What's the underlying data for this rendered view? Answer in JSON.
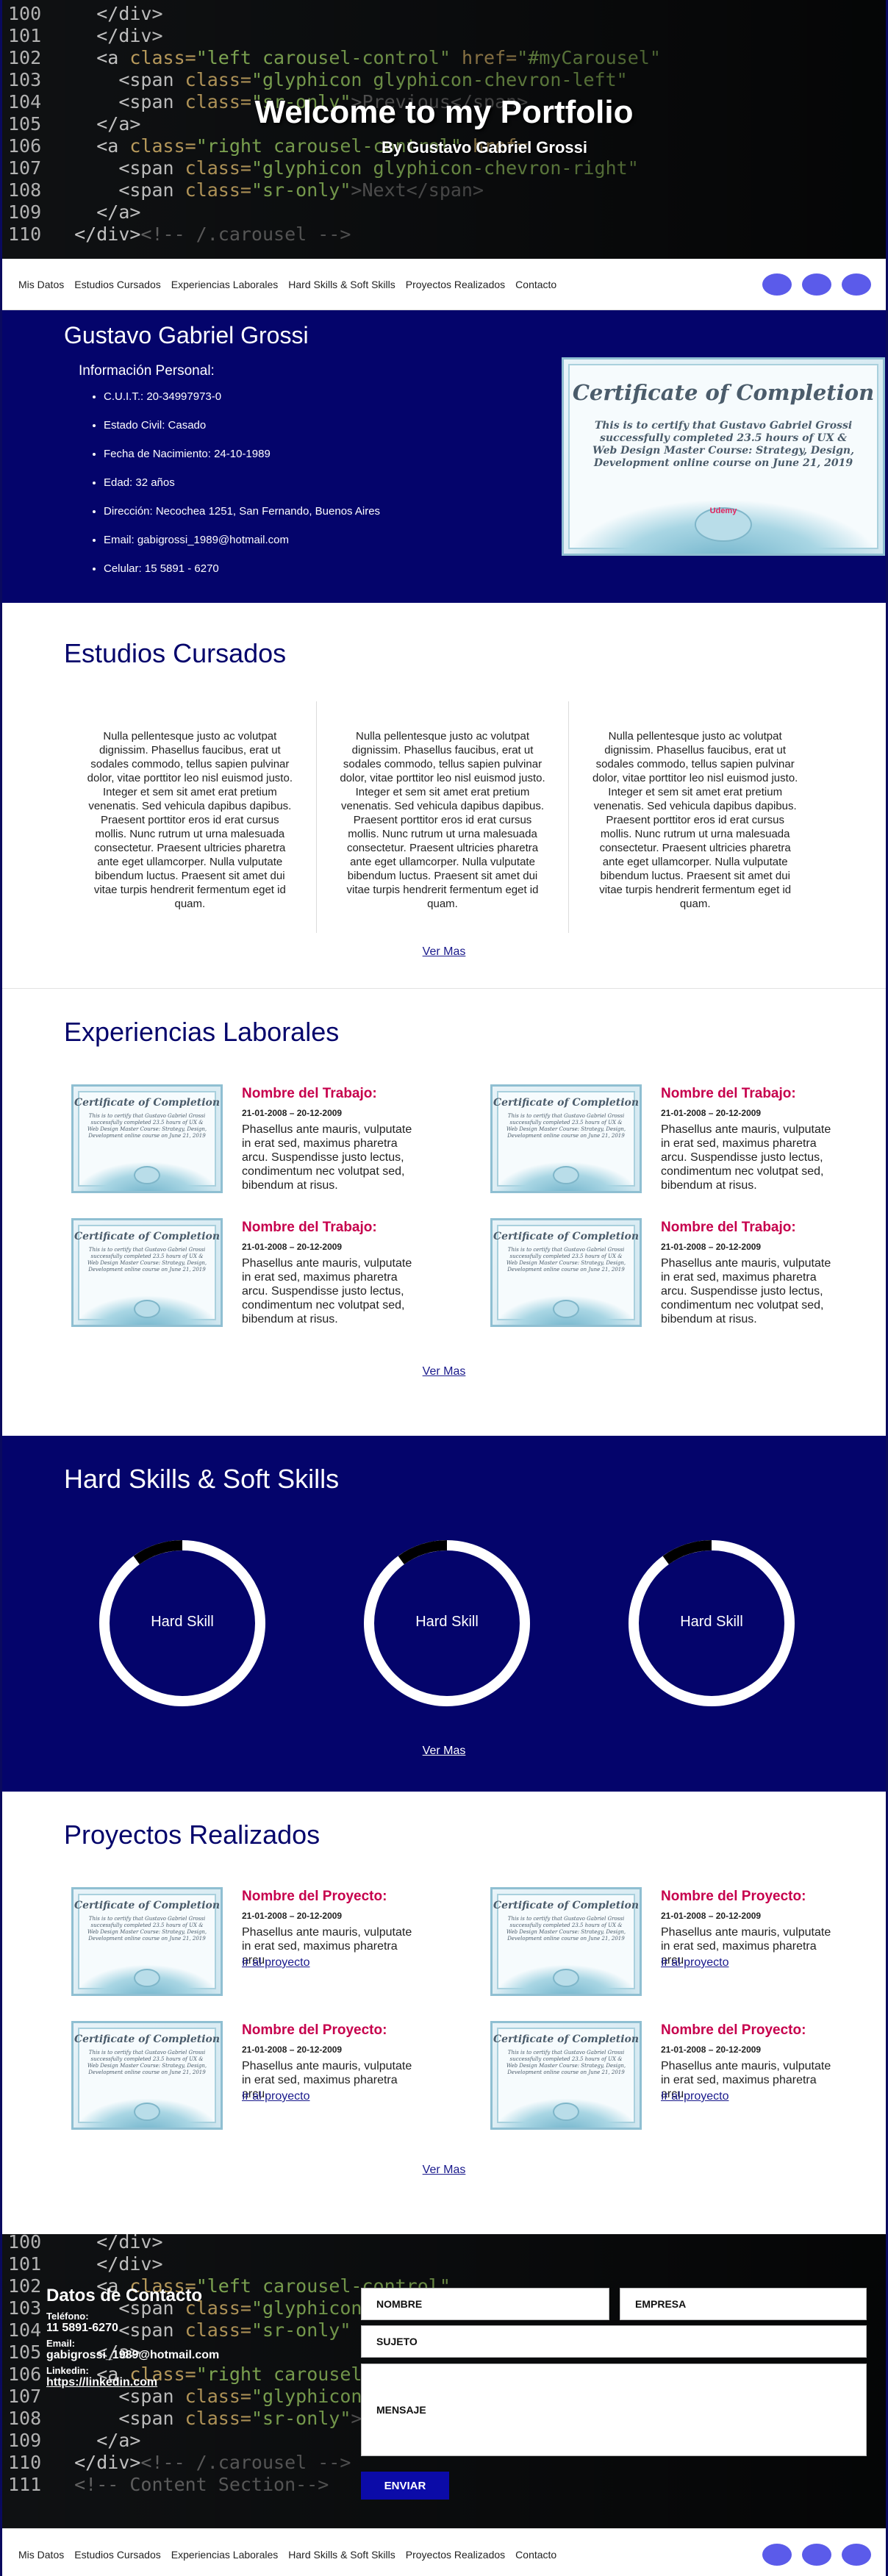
{
  "hero": {
    "title": "Welcome to my Portfolio",
    "subtitle": "By Gustavo Gabriel Grossi"
  },
  "nav": {
    "items": [
      "Mis Datos",
      "Estudios Cursados",
      "Experiencias Laborales",
      "Hard Skills & Soft Skills",
      "Proyectos Realizados",
      "Contacto"
    ]
  },
  "personal": {
    "name": "Gustavo Gabriel Grossi",
    "heading": "Información Personal:",
    "items": [
      "C.U.I.T.: 20-34997973-0",
      "Estado Civil: Casado",
      "Fecha de Nacimiento: 24-10-1989",
      "Edad: 32 años",
      "Dirección: Necochea 1251, San Fernando, Buenos Aires",
      "Email: gabigrossi_1989@hotmail.com",
      "Celular: 15 5891 - 6270"
    ]
  },
  "certificate": {
    "title": "Certificate of Completion",
    "text": "This is to certify that Gustavo Gabriel Grossi successfully completed 23.5 hours of UX & Web Design Master Course: Strategy, Design, Development online course on June 21, 2019",
    "brand": "Udemy"
  },
  "estudios": {
    "title": "Estudios Cursados",
    "paragraph": "Nulla pellentesque justo ac volutpat dignissim. Phasellus faucibus, erat ut sodales commodo, tellus sapien pulvinar dolor, vitae porttitor leo nisl euismod justo. Integer et sem sit amet erat pretium venenatis. Sed vehicula dapibus dapibus. Praesent porttitor eros id erat cursus mollis. Nunc rutrum ut urna malesuada consectetur. Praesent ultricies pharetra ante eget ullamcorper. Nulla vulputate bibendum luctus. Praesent sit amet dui vitae turpis hendrerit fermentum eget id quam.",
    "ver_mas": "Ver Mas"
  },
  "experiencias": {
    "title": "Experiencias Laborales",
    "job_title": "Nombre del Trabajo:",
    "dates": "21-01-2008 – 20-12-2009",
    "description": "Phasellus ante mauris, vulputate in erat sed, maximus pharetra arcu. Suspendisse justo lectus, condimentum nec volutpat sed, bibendum at risus.",
    "ver_mas": "Ver Mas"
  },
  "skills": {
    "title": "Hard Skills & Soft Skills",
    "items": [
      "Hard Skill",
      "Hard Skill",
      "Hard Skill"
    ],
    "levels": [
      0.9,
      0.9,
      0.9
    ],
    "ver_mas": "Ver Mas",
    "colors": {
      "ring": "#ffffff",
      "gap": "#000000"
    }
  },
  "proyectos": {
    "title": "Proyectos Realizados",
    "project_title": "Nombre del Proyecto:",
    "dates": "21-01-2008 – 20-12-2009",
    "description": "Phasellus ante mauris, vulputate in erat sed, maximus pharetra arcu.",
    "link": "Ir al proyecto",
    "ver_mas": "Ver Mas"
  },
  "contact": {
    "title": "Datos de Contacto",
    "phone_label": "Teléfono:",
    "phone": "11 5891-6270",
    "email_label": "Email:",
    "email": "gabigrossi_1989@hotmail.com",
    "linkedin_label": "Linkedin:",
    "linkedin": "https://linkedin.com",
    "placeholder_name": "NOMBRE",
    "placeholder_company": "EMPRESA",
    "placeholder_subject": "SUJETO",
    "placeholder_message": "MENSAJE",
    "send": "ENVIAR"
  },
  "colors": {
    "primary": "#04046b",
    "accent": "#c6004c",
    "dot": "#5b5bea"
  }
}
